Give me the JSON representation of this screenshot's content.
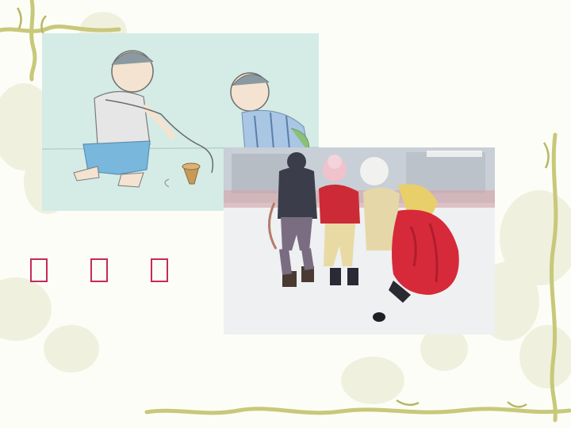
{
  "slide": {
    "background_color": "#fdfdf7",
    "decoration": "olive-vine-border"
  },
  "images": [
    {
      "name": "spinning-top-illustration",
      "description_icon": "two-boys-whipping-top-icon"
    },
    {
      "name": "ice-game-photo",
      "description_icon": "children-pushing-puck-on-ice-icon"
    }
  ],
  "caption": {
    "glyphs": [
      "□",
      "□",
      "□"
    ],
    "color": "#c42a5a"
  }
}
